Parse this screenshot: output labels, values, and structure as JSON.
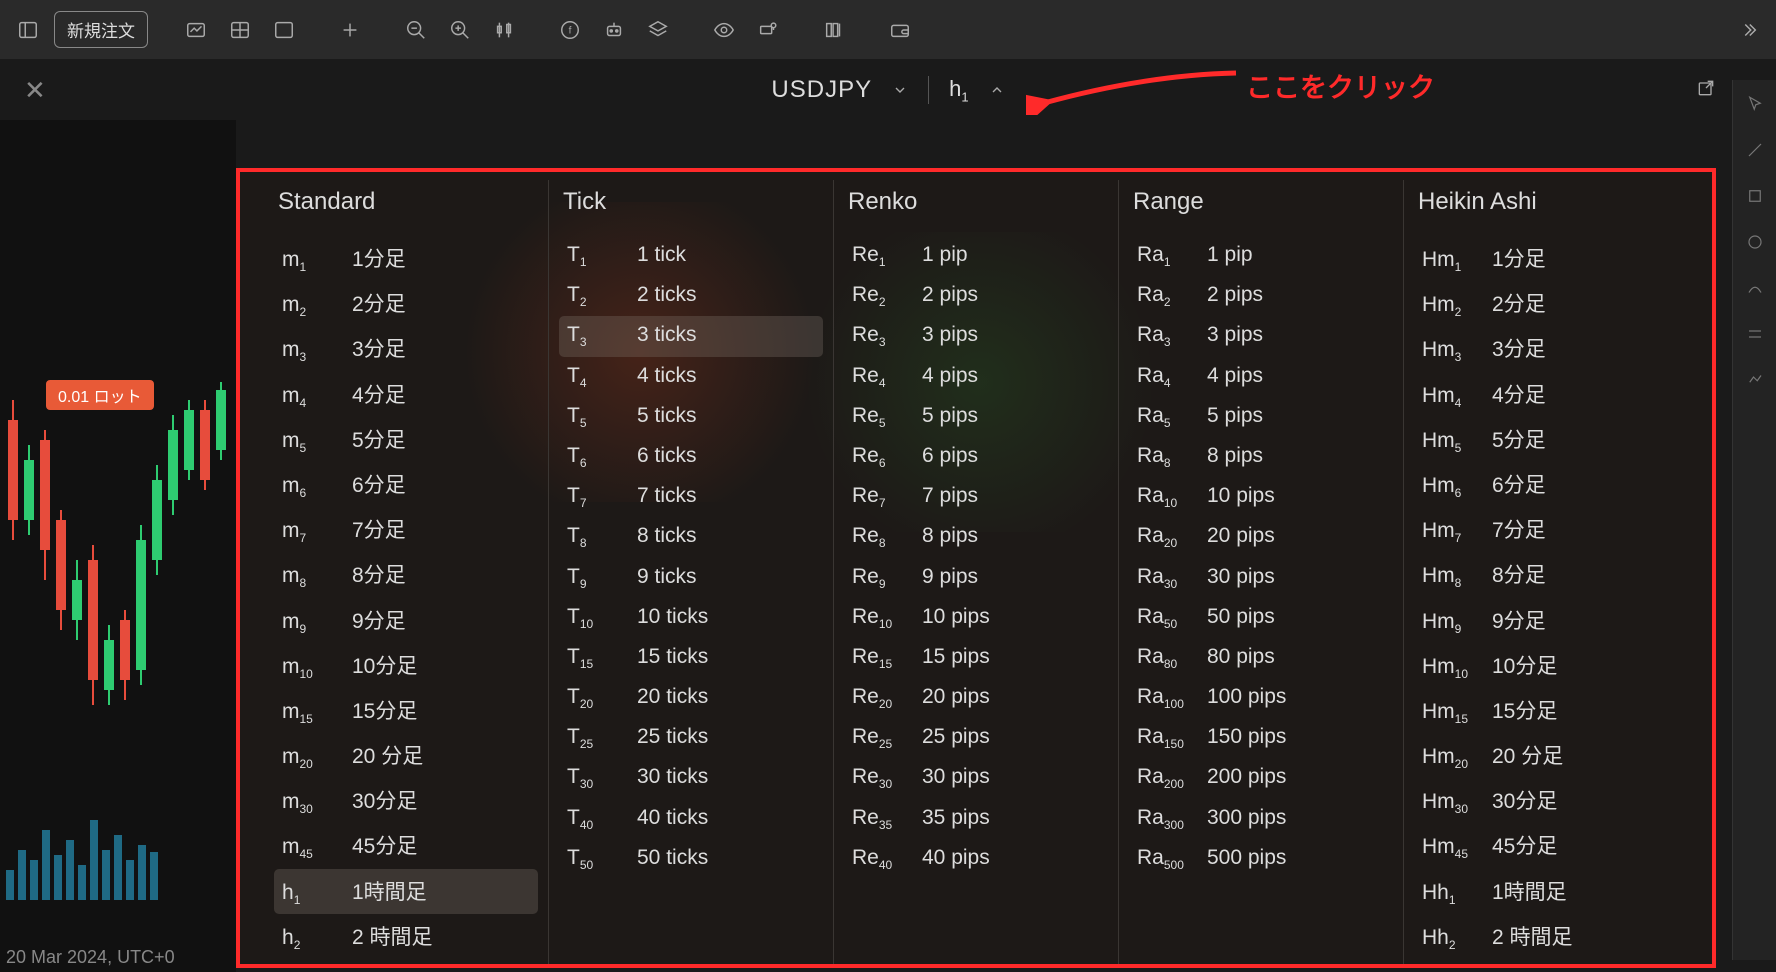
{
  "toolbar": {
    "new_order_label": "新規注文"
  },
  "symbol_bar": {
    "symbol": "USDJPY",
    "timeframe_prefix": "h",
    "timeframe_sub": "1"
  },
  "annotation": {
    "text": "ここをクリック"
  },
  "chart": {
    "lot_badge": "0.01 ロット",
    "date_label": "20 Mar 2024, UTC+0"
  },
  "dropdown": {
    "columns": [
      {
        "header": "Standard",
        "items": [
          {
            "prefix": "m",
            "sub": "1",
            "label": "1分足",
            "selected": false
          },
          {
            "prefix": "m",
            "sub": "2",
            "label": "2分足",
            "selected": false
          },
          {
            "prefix": "m",
            "sub": "3",
            "label": "3分足",
            "selected": false
          },
          {
            "prefix": "m",
            "sub": "4",
            "label": "4分足",
            "selected": false
          },
          {
            "prefix": "m",
            "sub": "5",
            "label": "5分足",
            "selected": false
          },
          {
            "prefix": "m",
            "sub": "6",
            "label": "6分足",
            "selected": false
          },
          {
            "prefix": "m",
            "sub": "7",
            "label": "7分足",
            "selected": false
          },
          {
            "prefix": "m",
            "sub": "8",
            "label": "8分足",
            "selected": false
          },
          {
            "prefix": "m",
            "sub": "9",
            "label": "9分足",
            "selected": false
          },
          {
            "prefix": "m",
            "sub": "10",
            "label": "10分足",
            "selected": false
          },
          {
            "prefix": "m",
            "sub": "15",
            "label": "15分足",
            "selected": false
          },
          {
            "prefix": "m",
            "sub": "20",
            "label": "20 分足",
            "selected": false
          },
          {
            "prefix": "m",
            "sub": "30",
            "label": "30分足",
            "selected": false
          },
          {
            "prefix": "m",
            "sub": "45",
            "label": "45分足",
            "selected": false
          },
          {
            "prefix": "h",
            "sub": "1",
            "label": "1時間足",
            "selected": true
          },
          {
            "prefix": "h",
            "sub": "2",
            "label": "2 時間足",
            "selected": false
          }
        ]
      },
      {
        "header": "Tick",
        "items": [
          {
            "prefix": "T",
            "sub": "1",
            "label": "1 tick",
            "selected": false
          },
          {
            "prefix": "T",
            "sub": "2",
            "label": "2 ticks",
            "selected": false
          },
          {
            "prefix": "T",
            "sub": "3",
            "label": "3 ticks",
            "selected": true
          },
          {
            "prefix": "T",
            "sub": "4",
            "label": "4 ticks",
            "selected": false
          },
          {
            "prefix": "T",
            "sub": "5",
            "label": "5 ticks",
            "selected": false
          },
          {
            "prefix": "T",
            "sub": "6",
            "label": "6 ticks",
            "selected": false
          },
          {
            "prefix": "T",
            "sub": "7",
            "label": "7 ticks",
            "selected": false
          },
          {
            "prefix": "T",
            "sub": "8",
            "label": "8 ticks",
            "selected": false
          },
          {
            "prefix": "T",
            "sub": "9",
            "label": "9 ticks",
            "selected": false
          },
          {
            "prefix": "T",
            "sub": "10",
            "label": "10 ticks",
            "selected": false
          },
          {
            "prefix": "T",
            "sub": "15",
            "label": "15 ticks",
            "selected": false
          },
          {
            "prefix": "T",
            "sub": "20",
            "label": "20 ticks",
            "selected": false
          },
          {
            "prefix": "T",
            "sub": "25",
            "label": "25 ticks",
            "selected": false
          },
          {
            "prefix": "T",
            "sub": "30",
            "label": "30 ticks",
            "selected": false
          },
          {
            "prefix": "T",
            "sub": "40",
            "label": "40 ticks",
            "selected": false
          },
          {
            "prefix": "T",
            "sub": "50",
            "label": "50 ticks",
            "selected": false
          }
        ]
      },
      {
        "header": "Renko",
        "items": [
          {
            "prefix": "Re",
            "sub": "1",
            "label": "1 pip",
            "selected": false
          },
          {
            "prefix": "Re",
            "sub": "2",
            "label": "2 pips",
            "selected": false
          },
          {
            "prefix": "Re",
            "sub": "3",
            "label": "3 pips",
            "selected": false
          },
          {
            "prefix": "Re",
            "sub": "4",
            "label": "4 pips",
            "selected": false
          },
          {
            "prefix": "Re",
            "sub": "5",
            "label": "5 pips",
            "selected": false
          },
          {
            "prefix": "Re",
            "sub": "6",
            "label": "6 pips",
            "selected": false
          },
          {
            "prefix": "Re",
            "sub": "7",
            "label": "7 pips",
            "selected": false
          },
          {
            "prefix": "Re",
            "sub": "8",
            "label": "8 pips",
            "selected": false
          },
          {
            "prefix": "Re",
            "sub": "9",
            "label": "9 pips",
            "selected": false
          },
          {
            "prefix": "Re",
            "sub": "10",
            "label": "10 pips",
            "selected": false
          },
          {
            "prefix": "Re",
            "sub": "15",
            "label": "15 pips",
            "selected": false
          },
          {
            "prefix": "Re",
            "sub": "20",
            "label": "20 pips",
            "selected": false
          },
          {
            "prefix": "Re",
            "sub": "25",
            "label": "25 pips",
            "selected": false
          },
          {
            "prefix": "Re",
            "sub": "30",
            "label": "30 pips",
            "selected": false
          },
          {
            "prefix": "Re",
            "sub": "35",
            "label": "35 pips",
            "selected": false
          },
          {
            "prefix": "Re",
            "sub": "40",
            "label": "40 pips",
            "selected": false
          }
        ]
      },
      {
        "header": "Range",
        "items": [
          {
            "prefix": "Ra",
            "sub": "1",
            "label": "1 pip",
            "selected": false
          },
          {
            "prefix": "Ra",
            "sub": "2",
            "label": "2 pips",
            "selected": false
          },
          {
            "prefix": "Ra",
            "sub": "3",
            "label": "3 pips",
            "selected": false
          },
          {
            "prefix": "Ra",
            "sub": "4",
            "label": "4 pips",
            "selected": false
          },
          {
            "prefix": "Ra",
            "sub": "5",
            "label": "5 pips",
            "selected": false
          },
          {
            "prefix": "Ra",
            "sub": "8",
            "label": "8 pips",
            "selected": false
          },
          {
            "prefix": "Ra",
            "sub": "10",
            "label": "10 pips",
            "selected": false
          },
          {
            "prefix": "Ra",
            "sub": "20",
            "label": "20 pips",
            "selected": false
          },
          {
            "prefix": "Ra",
            "sub": "30",
            "label": "30 pips",
            "selected": false
          },
          {
            "prefix": "Ra",
            "sub": "50",
            "label": "50 pips",
            "selected": false
          },
          {
            "prefix": "Ra",
            "sub": "80",
            "label": "80 pips",
            "selected": false
          },
          {
            "prefix": "Ra",
            "sub": "100",
            "label": "100 pips",
            "selected": false
          },
          {
            "prefix": "Ra",
            "sub": "150",
            "label": "150 pips",
            "selected": false
          },
          {
            "prefix": "Ra",
            "sub": "200",
            "label": "200 pips",
            "selected": false
          },
          {
            "prefix": "Ra",
            "sub": "300",
            "label": "300 pips",
            "selected": false
          },
          {
            "prefix": "Ra",
            "sub": "500",
            "label": "500 pips",
            "selected": false
          }
        ]
      },
      {
        "header": "Heikin Ashi",
        "items": [
          {
            "prefix": "Hm",
            "sub": "1",
            "label": "1分足",
            "selected": false
          },
          {
            "prefix": "Hm",
            "sub": "2",
            "label": "2分足",
            "selected": false
          },
          {
            "prefix": "Hm",
            "sub": "3",
            "label": "3分足",
            "selected": false
          },
          {
            "prefix": "Hm",
            "sub": "4",
            "label": "4分足",
            "selected": false
          },
          {
            "prefix": "Hm",
            "sub": "5",
            "label": "5分足",
            "selected": false
          },
          {
            "prefix": "Hm",
            "sub": "6",
            "label": "6分足",
            "selected": false
          },
          {
            "prefix": "Hm",
            "sub": "7",
            "label": "7分足",
            "selected": false
          },
          {
            "prefix": "Hm",
            "sub": "8",
            "label": "8分足",
            "selected": false
          },
          {
            "prefix": "Hm",
            "sub": "9",
            "label": "9分足",
            "selected": false
          },
          {
            "prefix": "Hm",
            "sub": "10",
            "label": "10分足",
            "selected": false
          },
          {
            "prefix": "Hm",
            "sub": "15",
            "label": "15分足",
            "selected": false
          },
          {
            "prefix": "Hm",
            "sub": "20",
            "label": "20 分足",
            "selected": false
          },
          {
            "prefix": "Hm",
            "sub": "30",
            "label": "30分足",
            "selected": false
          },
          {
            "prefix": "Hm",
            "sub": "45",
            "label": "45分足",
            "selected": false
          },
          {
            "prefix": "Hh",
            "sub": "1",
            "label": "1時間足",
            "selected": false
          },
          {
            "prefix": "Hh",
            "sub": "2",
            "label": "2 時間足",
            "selected": false
          }
        ]
      }
    ]
  }
}
